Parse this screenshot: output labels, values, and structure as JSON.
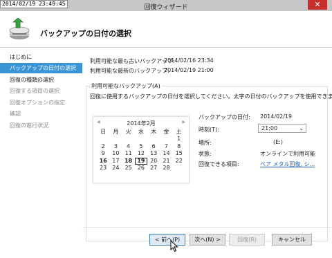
{
  "window": {
    "timestamp": "2014/02/19 23:49:45",
    "title": "回復ウィザード",
    "close_glyph": "✕"
  },
  "header": {
    "title": "バックアップの日付の選択"
  },
  "sidebar": {
    "items": [
      {
        "label": "はじめに",
        "state": "done"
      },
      {
        "label": "バックアップの日付の選択",
        "state": "active"
      },
      {
        "label": "回復の種類の選択",
        "state": "done"
      },
      {
        "label": "回復する項目の選択",
        "state": "pending"
      },
      {
        "label": "回復オプションの指定",
        "state": "pending"
      },
      {
        "label": "確認",
        "state": "pending"
      },
      {
        "label": "回復の進行状況",
        "state": "pending"
      }
    ]
  },
  "info": {
    "oldest_label": "利用可能な最も古いバックアップ:",
    "oldest_value": "2014/02/16 23:34",
    "newest_label": "利用可能な最新のバックアップ:",
    "newest_value": "2014/02/19 21:00"
  },
  "available": {
    "group_title": "利用可能なバックアップ(A)",
    "description": "回復に使用するバックアップの日付を選択してください。太字の日付のバックアップを使用できます。"
  },
  "calendar": {
    "prev": "◀",
    "next": "▶",
    "month": "2014年2月",
    "weekdays": [
      "日",
      "月",
      "火",
      "水",
      "木",
      "金",
      "土"
    ],
    "weeks": [
      [
        "",
        "",
        "",
        "",
        "",
        "",
        "1"
      ],
      [
        "2",
        "3",
        "4",
        "5",
        "6",
        "7",
        "8"
      ],
      [
        "9",
        "10",
        "11",
        "12",
        "13",
        "14",
        "15"
      ],
      [
        "16",
        "17",
        "18",
        "19",
        "20",
        "21",
        "22"
      ],
      [
        "23",
        "24",
        "25",
        "26",
        "27",
        "28",
        ""
      ]
    ],
    "bold_days": [
      "16",
      "18",
      "19"
    ],
    "selected_day": "19"
  },
  "details": {
    "date_label": "バックアップの日付:",
    "date_value": "2014/02/19",
    "time_label": "時刻(T):",
    "time_value": "21:00",
    "location_label": "場所:",
    "location_value": "(E:)",
    "status_label": "状態:",
    "status_value": "オンラインで利用可能",
    "items_label": "回復できる項目:",
    "items_link": "ベア メタル回復, シ..."
  },
  "buttons": {
    "back": "< 前へ(P)",
    "next": "次へ(N) >",
    "recover": "回復(R)",
    "cancel": "キャンセル"
  },
  "colors": {
    "selection": "#3a95d7",
    "link": "#1a5fb4",
    "close": "#c9302c"
  }
}
